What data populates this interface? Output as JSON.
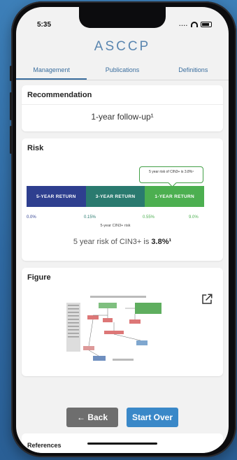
{
  "status_bar": {
    "time": "5:35",
    "signal": "....",
    "wifi": "wifi-icon",
    "battery": "battery-icon"
  },
  "app": {
    "logo": "ASCCP"
  },
  "tabs": [
    {
      "label": "Management",
      "active": true
    },
    {
      "label": "Publications",
      "active": false
    },
    {
      "label": "Definitions",
      "active": false
    }
  ],
  "recommendation": {
    "title": "Recommendation",
    "value": "1-year follow-up¹"
  },
  "risk": {
    "title": "Risk",
    "callout": "5 year risk of CIN3+ is 3.8%¹",
    "segments": [
      {
        "label": "5-YEAR RETURN",
        "color": "#2e3f8f"
      },
      {
        "label": "3-YEAR RETURN",
        "color": "#2a7a6f"
      },
      {
        "label": "1-YEAR RETURN",
        "color": "#4caf50"
      }
    ],
    "ticks": [
      {
        "label": "0.0%",
        "color": "#2e3f8f"
      },
      {
        "label": "0.15%",
        "color": "#2a7a6f"
      },
      {
        "label": "0.55%",
        "color": "#4caf50"
      },
      {
        "label": "9.0%",
        "color": "#4caf50"
      }
    ],
    "axis_caption": "5-year CIN3+ risk",
    "sentence_prefix": "5 year risk of CIN3+ is ",
    "sentence_value": "3.8%¹"
  },
  "figure": {
    "title": "Figure",
    "icon": "external-link-icon"
  },
  "buttons": {
    "back": "← Back",
    "start_over": "Start Over"
  },
  "references": {
    "title": "References"
  }
}
